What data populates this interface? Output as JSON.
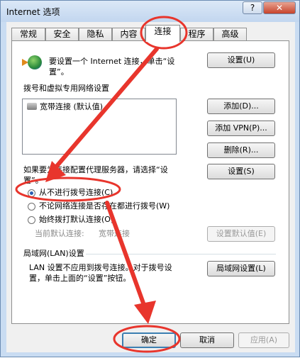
{
  "window": {
    "title": "Internet 选项",
    "help": "?",
    "close": "✕"
  },
  "tabs": [
    "常规",
    "安全",
    "隐私",
    "内容",
    "连接",
    "程序",
    "高级"
  ],
  "active_tab": 4,
  "setup": {
    "text1": "要设置一个 Internet 连接，单击“设",
    "text2": "置”。",
    "button": "设置(U)"
  },
  "dialup": {
    "heading": "拨号和虚拟专用网络设置",
    "list_item": "宽带连接 (默认值)",
    "add": "添加(D)...",
    "add_vpn": "添加 VPN(P)...",
    "remove": "删除(R)...",
    "proxy_text1": "如果要为连接配置代理服务器，请选择“设",
    "proxy_text2": "置”。",
    "settings": "设置(S)",
    "options": [
      "从不进行拨号连接(C)",
      "不论网络连接是否存在都进行拨号(W)",
      "始终拨打默认连接(O)"
    ],
    "selected_option": 0,
    "current_default_label": "当前默认连接:",
    "current_default_value": "宽带连接",
    "set_default": "设置默认值(E)"
  },
  "lan": {
    "heading": "局域网(LAN)设置",
    "text1": "LAN 设置不应用到拨号连接。对于拨号设",
    "text2": "置，单击上面的“设置”按钮。",
    "button": "局域网设置(L)"
  },
  "footer": {
    "ok": "确定",
    "cancel": "取消",
    "apply": "应用(A)"
  },
  "colors": {
    "annotation": "#e8352c",
    "titlebar": "#c9dcf2",
    "close": "#c7432b"
  }
}
